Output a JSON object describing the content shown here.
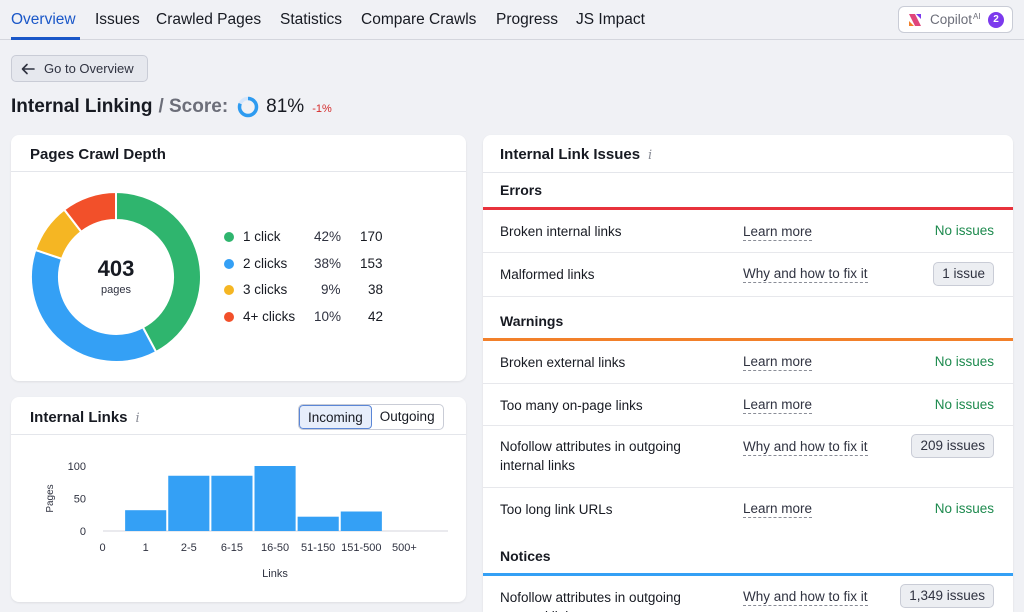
{
  "nav": {
    "tabs": [
      "Overview",
      "Issues",
      "Crawled Pages",
      "Statistics",
      "Compare Crawls",
      "Progress",
      "JS Impact"
    ],
    "copilot_label": "Copilot",
    "copilot_sup": "AI",
    "copilot_count": "2"
  },
  "back_button": "Go to Overview",
  "title": {
    "main": "Internal Linking",
    "sep": "/ Score:",
    "score": "81%",
    "score_fraction": 0.81,
    "delta": "-1%"
  },
  "crawl_depth": {
    "title": "Pages Crawl Depth",
    "total": "403",
    "total_label": "pages",
    "items": [
      {
        "label": "1 click",
        "pct": "42%",
        "count": "170",
        "value": 170,
        "color": "#2fb56e"
      },
      {
        "label": "2 clicks",
        "pct": "38%",
        "count": "153",
        "value": 153,
        "color": "#34a0f5"
      },
      {
        "label": "3 clicks",
        "pct": "9%",
        "count": "38",
        "value": 38,
        "color": "#f5b623"
      },
      {
        "label": "4+ clicks",
        "pct": "10%",
        "count": "42",
        "value": 42,
        "color": "#f2502a"
      }
    ]
  },
  "internal_links": {
    "title": "Internal Links",
    "toggle": [
      "Incoming",
      "Outgoing"
    ],
    "toggle_active": "Incoming"
  },
  "chart_data": {
    "type": "bar",
    "categories": [
      "0",
      "1",
      "2-5",
      "6-15",
      "16-50",
      "51-150",
      "151-500",
      "500+"
    ],
    "values": [
      0,
      32,
      85,
      85,
      100,
      22,
      30,
      0
    ],
    "xlabel": "Links",
    "ylabel": "Pages",
    "yticks": [
      "0",
      "50",
      "100"
    ],
    "ylim": [
      0,
      100
    ],
    "color": "#34a0f5"
  },
  "issues": {
    "title": "Internal Link Issues",
    "sections": {
      "errors": "Errors",
      "warnings": "Warnings",
      "notices": "Notices"
    },
    "colors": {
      "errors": "#e8323c",
      "warnings": "#f2802a",
      "notices": "#34a0f5"
    },
    "rows": [
      {
        "name": "Broken internal links",
        "link": "Learn more",
        "status": "No issues"
      },
      {
        "name": "Malformed links",
        "link": "Why and how to fix it",
        "badge": "1 issue"
      },
      {
        "name": "Broken external links",
        "link": "Learn more",
        "status": "No issues"
      },
      {
        "name": "Too many on-page links",
        "link": "Learn more",
        "status": "No issues"
      },
      {
        "name": "Nofollow attributes in outgoing internal links",
        "link": "Why and how to fix it",
        "badge": "209 issues"
      },
      {
        "name": "Too long link URLs",
        "link": "Learn more",
        "status": "No issues"
      },
      {
        "name": "Nofollow attributes in outgoing external links",
        "link": "Why and how to fix it",
        "badge": "1,349 issues"
      }
    ]
  }
}
